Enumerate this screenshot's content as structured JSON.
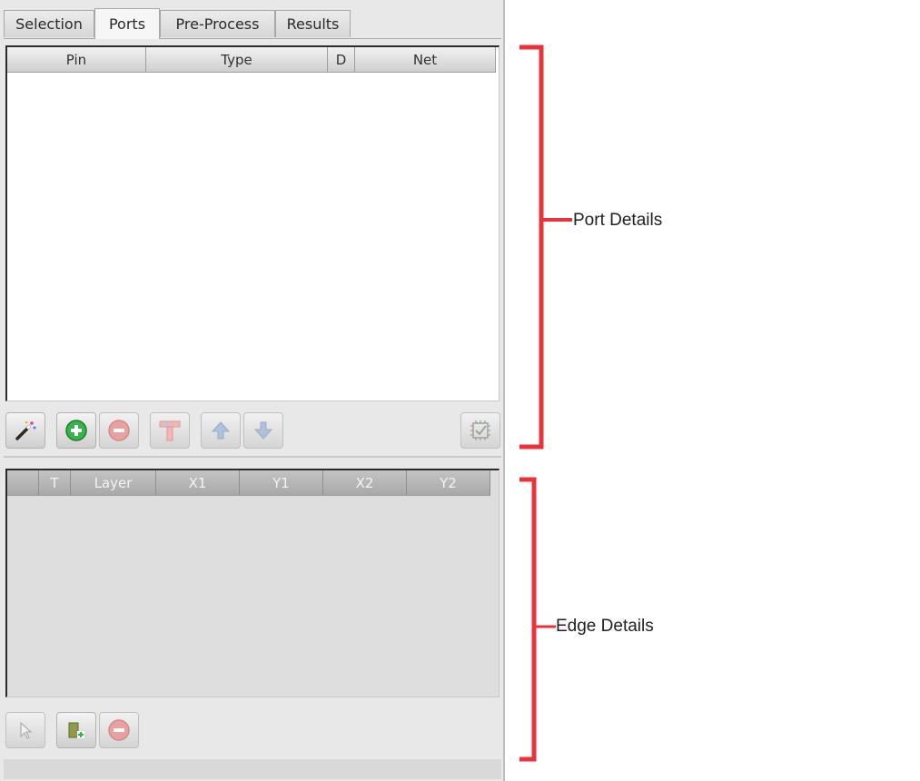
{
  "tabs": [
    {
      "label": "Selection"
    },
    {
      "label": "Ports"
    },
    {
      "label": "Pre-Process"
    },
    {
      "label": "Results"
    }
  ],
  "ports_table": {
    "columns": [
      "Pin",
      "Type",
      "D",
      "Net"
    ]
  },
  "ports_toolbar": {
    "buttons": [
      {
        "icon": "magic-wand-icon",
        "enabled": true
      },
      {
        "icon": "add-circle-icon",
        "enabled": true,
        "color": "#36b34a"
      },
      {
        "icon": "remove-circle-icon",
        "enabled": false,
        "color": "#e05252"
      },
      {
        "icon": "terminal-icon",
        "enabled": false
      },
      {
        "icon": "arrow-up-icon",
        "enabled": false
      },
      {
        "icon": "arrow-down-icon",
        "enabled": false
      },
      {
        "icon": "chip-check-icon",
        "enabled": false
      }
    ]
  },
  "edge_table": {
    "columns": [
      "",
      "T",
      "Layer",
      "X1",
      "Y1",
      "X2",
      "Y2"
    ]
  },
  "edge_toolbar": {
    "buttons": [
      {
        "icon": "pointer-icon",
        "enabled": false
      },
      {
        "icon": "add-edge-icon",
        "enabled": true
      },
      {
        "icon": "remove-circle-icon",
        "enabled": false
      }
    ]
  },
  "annotations": {
    "port_details": "Port Details",
    "edge_details": "Edge Details",
    "bracket_color": "#e8333b"
  }
}
